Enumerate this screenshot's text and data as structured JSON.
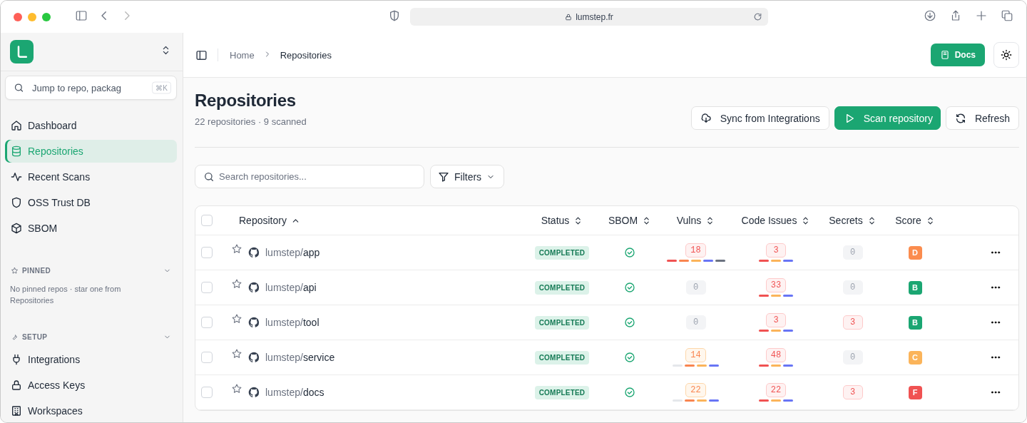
{
  "browser": {
    "address": "lumstep.fr"
  },
  "sidebar": {
    "search": {
      "placeholder": "Jump to repo, packag",
      "shortcut": "⌘K"
    },
    "nav": [
      {
        "label": "Dashboard",
        "selected": false
      },
      {
        "label": "Repositories",
        "selected": true
      },
      {
        "label": "Recent Scans",
        "selected": false
      },
      {
        "label": "OSS Trust DB",
        "selected": false
      },
      {
        "label": "SBOM",
        "selected": false
      }
    ],
    "pinned": {
      "title": "PINNED",
      "empty_text": "No pinned repos · star one from Repositories"
    },
    "setup": {
      "title": "SETUP",
      "items": [
        {
          "label": "Integrations"
        },
        {
          "label": "Access Keys"
        },
        {
          "label": "Workspaces"
        }
      ]
    }
  },
  "breadcrumb": [
    {
      "label": "Home",
      "selected": false
    },
    {
      "label": "Repositories",
      "selected": true
    }
  ],
  "header_buttons": {
    "docs": "Docs"
  },
  "page": {
    "title": "Repositories",
    "subtitle": "22 repositories · 9 scanned",
    "actions": [
      {
        "label": "Sync from Integrations",
        "kind": "sync"
      },
      {
        "label": "Scan repository",
        "kind": "scan"
      },
      {
        "label": "Refresh",
        "kind": "refresh"
      }
    ],
    "search": {
      "placeholder": "Search repositories..."
    },
    "filters": "Filters"
  },
  "table": {
    "select_all": {
      "checked": false
    },
    "columns": [
      {
        "label": "Repository",
        "sorted": true
      },
      {
        "label": "Status",
        "sorted": false
      },
      {
        "label": "SBOM",
        "sorted": false
      },
      {
        "label": "Vulns",
        "sorted": false
      },
      {
        "label": "Code Issues",
        "sorted": false
      },
      {
        "label": "Secrets",
        "sorted": false
      },
      {
        "label": "Score",
        "sorted": false
      }
    ],
    "rows": [
      {
        "checked": false,
        "owner": "lumstep/",
        "name": "app",
        "status": "COMPLETED",
        "sbom": true,
        "vulns": {
          "count": "18",
          "kind": "critical",
          "bars": [
            {
              "color": "#f05252"
            },
            {
              "color": "#f98550"
            },
            {
              "color": "#fbb45a"
            },
            {
              "color": "#6875f5"
            },
            {
              "color": "#6b7280"
            }
          ]
        },
        "code": {
          "count": "3",
          "kind": "critical",
          "bars": [
            {
              "color": "#f05252"
            },
            {
              "color": "#fbb45a"
            },
            {
              "color": "#6875f5"
            }
          ]
        },
        "secrets": {
          "count": "0",
          "kind": "none"
        },
        "score": {
          "grade": "D",
          "color": "#fb8c4e"
        }
      },
      {
        "checked": false,
        "owner": "lumstep/",
        "name": "api",
        "status": "COMPLETED",
        "sbom": true,
        "vulns": {
          "count": "0",
          "kind": "none"
        },
        "code": {
          "count": "33",
          "kind": "critical",
          "bars": [
            {
              "color": "#f05252"
            },
            {
              "color": "#fbb45a"
            },
            {
              "color": "#6875f5"
            }
          ]
        },
        "secrets": {
          "count": "0",
          "kind": "none"
        },
        "score": {
          "grade": "B",
          "color": "#1ba672"
        }
      },
      {
        "checked": false,
        "owner": "lumstep/",
        "name": "tool",
        "status": "COMPLETED",
        "sbom": true,
        "vulns": {
          "count": "0",
          "kind": "none"
        },
        "code": {
          "count": "3",
          "kind": "critical",
          "bars": [
            {
              "color": "#f05252"
            },
            {
              "color": "#fbb45a"
            },
            {
              "color": "#6875f5"
            }
          ]
        },
        "secrets": {
          "count": "3",
          "kind": "critical"
        },
        "score": {
          "grade": "B",
          "color": "#1ba672"
        }
      },
      {
        "checked": false,
        "owner": "lumstep/",
        "name": "service",
        "status": "COMPLETED",
        "sbom": true,
        "vulns": {
          "count": "14",
          "kind": "high",
          "bars": [
            {
              "color": "#e5e7eb"
            },
            {
              "color": "#f98550"
            },
            {
              "color": "#fbb45a"
            },
            {
              "color": "#6875f5"
            }
          ]
        },
        "code": {
          "count": "48",
          "kind": "critical",
          "bars": [
            {
              "color": "#f05252"
            },
            {
              "color": "#fbb45a"
            },
            {
              "color": "#6875f5"
            }
          ]
        },
        "secrets": {
          "count": "0",
          "kind": "none"
        },
        "score": {
          "grade": "C",
          "color": "#fbb45a"
        }
      },
      {
        "checked": false,
        "owner": "lumstep/",
        "name": "docs",
        "status": "COMPLETED",
        "sbom": true,
        "vulns": {
          "count": "22",
          "kind": "high",
          "bars": [
            {
              "color": "#e5e7eb"
            },
            {
              "color": "#f98550"
            },
            {
              "color": "#fbb45a"
            },
            {
              "color": "#6875f5"
            }
          ]
        },
        "code": {
          "count": "22",
          "kind": "critical",
          "bars": [
            {
              "color": "#f05252"
            },
            {
              "color": "#fbb45a"
            },
            {
              "color": "#6875f5"
            }
          ]
        },
        "secrets": {
          "count": "3",
          "kind": "critical"
        },
        "score": {
          "grade": "F",
          "color": "#f05252"
        }
      }
    ]
  }
}
